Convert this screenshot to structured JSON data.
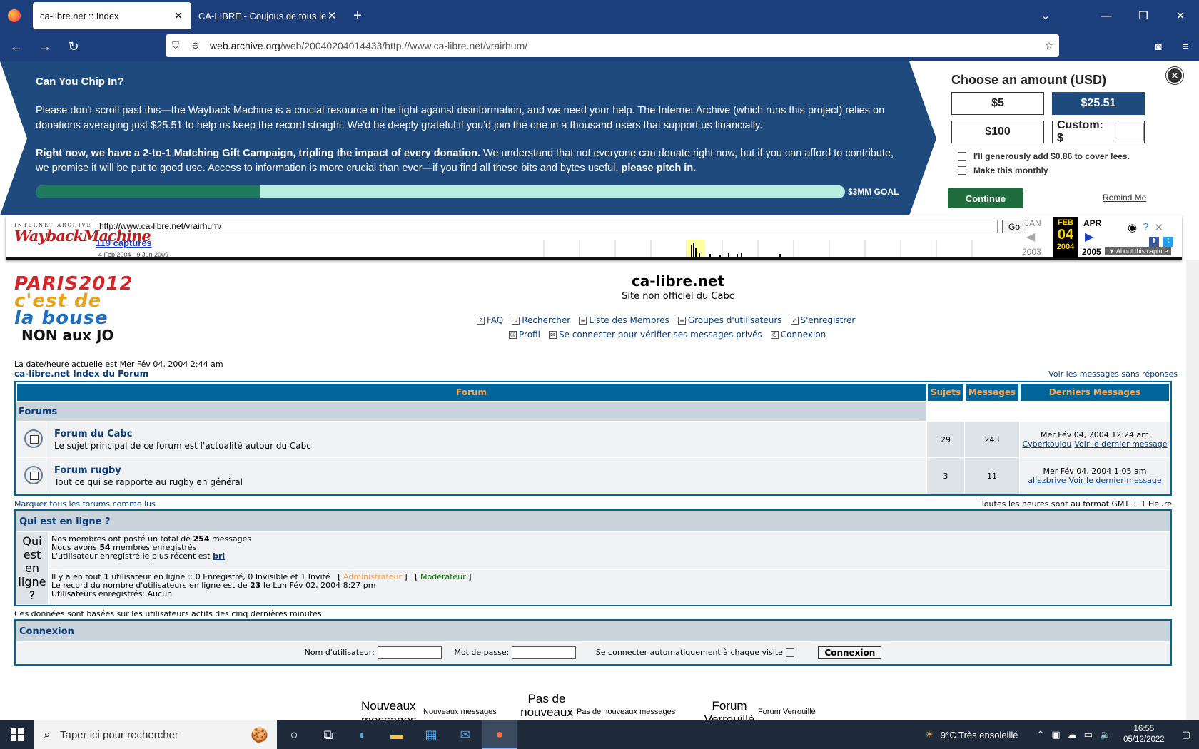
{
  "browser": {
    "tabs": [
      {
        "title": "ca-libre.net :: Index",
        "active": true
      },
      {
        "title": "CA-LIBRE - Coujous de tous les pays",
        "active": false
      }
    ],
    "url_domain": "web.archive.org",
    "url_path": "/web/20040204014433/http://www.ca-libre.net/vrairhum/"
  },
  "donation": {
    "heading": "Can You Chip In?",
    "para1": "Please don't scroll past this—the Wayback Machine is a crucial resource in the fight against disinformation, and we need your help. The Internet Archive (which runs this project) relies on donations averaging just $25.51 to help us keep the record straight. We'd be deeply grateful if you'd join the one in a thousand users that support us financially.",
    "para2_bold": "Right now, we have a 2-to-1 Matching Gift Campaign, tripling the impact of every donation.",
    "para2_rest": " We understand that not everyone can donate right now, but if you can afford to contribute, we promise it will be put to good use. Access to information is more crucial than ever—if you find all these bits and bytes useful, ",
    "para2_end": "please pitch in.",
    "progress_fraction": 0.277,
    "goal": "$3MM GOAL",
    "choose_title": "Choose an amount (USD)",
    "amounts": [
      "$5",
      "$25.51",
      "$100"
    ],
    "custom_label": "Custom: $",
    "fee_label": "I'll generously add $0.86 to cover fees.",
    "monthly_label": "Make this monthly",
    "continue_label": "Continue",
    "remind_label": "Remind Me"
  },
  "wayback": {
    "logo_top": "INTERNET ARCHIVE",
    "logo_main": "WaybackMachine",
    "url_value": "http://www.ca-libre.net/vrairhum/",
    "go_label": "Go",
    "captures": "119 captures",
    "date_range": "4 Feb 2004 - 9 Jun 2009",
    "prev_month": "JAN",
    "cur_month": "FEB",
    "next_month": "APR",
    "cur_day": "04",
    "prev_year": "2003",
    "cur_year": "2004",
    "next_year": "2005",
    "about": "▼ About this capture"
  },
  "site": {
    "logo_lines": [
      "PARIS2012",
      "c'est de",
      "la bouse",
      "NON aux JO"
    ],
    "title": "ca-libre.net",
    "description": "Site non officiel du Cabc",
    "nav_row1": [
      "FAQ",
      "Rechercher",
      "Liste des Membres",
      "Groupes d'utilisateurs",
      "S'enregistrer"
    ],
    "nav_row2": [
      "Profil",
      "Se connecter pour vérifier ses messages privés",
      "Connexion"
    ],
    "datetime": "La date/heure actuelle est Mer Fév 04, 2004 2:44 am",
    "breadcrumb": "ca-libre.net Index du Forum",
    "unanswered": "Voir les messages sans réponses",
    "table_headers": [
      "Forum",
      "Sujets",
      "Messages",
      "Derniers Messages"
    ],
    "category": "Forums",
    "forums": [
      {
        "name": "Forum du Cabc",
        "desc": "Le sujet principal de ce forum est l'actualité autour du Cabc",
        "topics": "29",
        "posts": "243",
        "last_date": "Mer Fév 04, 2004 12:24 am",
        "last_user": "Cyberkoujou",
        "last_link": "Voir le dernier message"
      },
      {
        "name": "Forum rugby",
        "desc": "Tout ce qui se rapporte au rugby en général",
        "topics": "3",
        "posts": "11",
        "last_date": "Mer Fév 04, 2004 1:05 am",
        "last_user": "allezbrive",
        "last_link": "Voir le dernier message"
      }
    ],
    "mark_all": "Marquer tous les forums comme lus",
    "timezone": "Toutes les heures sont au format GMT + 1 Heure",
    "online_title": "Qui est en ligne ?",
    "online_big": "Qui est en ligne ?",
    "stats_1a": "Nos membres ont posté un total de ",
    "stats_1b": "254",
    "stats_1c": " messages",
    "stats_2a": "Nous avons ",
    "stats_2b": "54",
    "stats_2c": " membres enregistrés",
    "stats_3a": "L'utilisateur enregistré le plus récent est ",
    "stats_3b": "brl",
    "online_1a": "Il y a en tout ",
    "online_1b": "1",
    "online_1c": " utilisateur en ligne :: 0 Enregistré, 0 Invisible et 1 Invité   [ ",
    "admin": "Administrateur",
    "online_1d": " ]   [ ",
    "moderator": "Modérateur",
    "online_1e": " ]",
    "online_2a": "Le record du nombre d'utilisateurs en ligne est de ",
    "online_2b": "23",
    "online_2c": " le Lun Fév 02, 2004 8:27 pm",
    "online_3": "Utilisateurs enregistrés: Aucun",
    "active_info": "Ces données sont basées sur les utilisateurs actifs des cinq dernières minutes",
    "login_title": "Connexion",
    "login_user": "Nom d'utilisateur:",
    "login_pass": "Mot de passe:",
    "login_auto": "Se connecter automatiquement à chaque visite",
    "login_btn": "Connexion",
    "legend": [
      {
        "big": "Nouveaux messages",
        "small": "Nouveaux messages"
      },
      {
        "big": "Pas de nouveaux",
        "small": "Pas de nouveaux messages"
      },
      {
        "big": "Forum Verrouillé",
        "small": "Forum Verrouillé"
      }
    ]
  },
  "taskbar": {
    "search_placeholder": "Taper ici pour rechercher",
    "weather": "9°C  Très ensoleillé",
    "time": "16:55",
    "date": "05/12/2022"
  },
  "colors": {
    "chrome": "#1c3f7c",
    "donate_bg": "#1f4a7e",
    "forum_header": "#006699",
    "forum_header_text": "#ffa34f",
    "link": "#0a3d7a"
  }
}
